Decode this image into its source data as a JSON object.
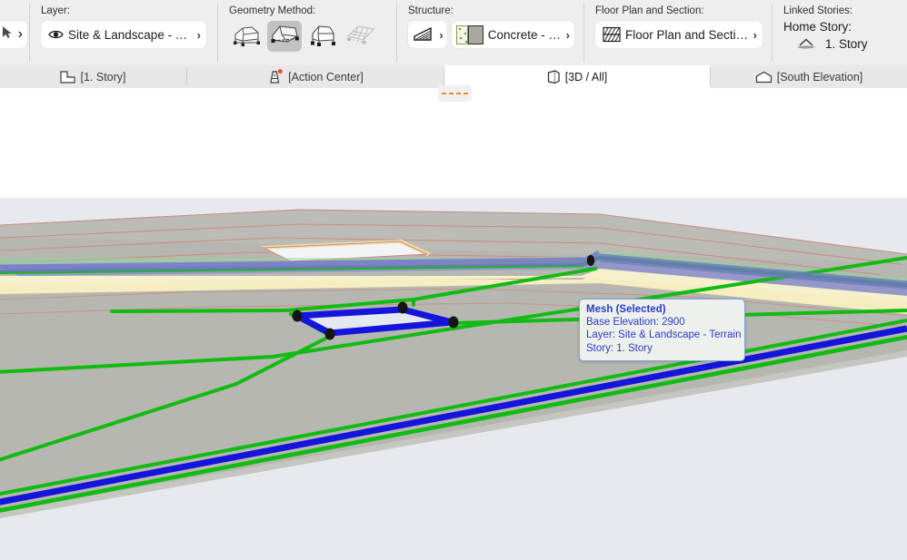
{
  "toolbar": {
    "groups": {
      "tool_edge": {
        "icon": "arrow-tool-icon",
        "chevron": "›"
      },
      "layer": {
        "label": "Layer:",
        "icon": "eye-icon",
        "value": "Site & Landscape - Terrain",
        "chevron": "›"
      },
      "geometry_method": {
        "label": "Geometry Method:",
        "options": [
          {
            "name": "mesh-polygonal-icon",
            "state": "normal"
          },
          {
            "name": "mesh-rectangular-icon",
            "state": "active"
          },
          {
            "name": "mesh-rotated-rectangle-icon",
            "state": "normal"
          },
          {
            "name": "mesh-grid-icon",
            "state": "disabled"
          }
        ]
      },
      "structure": {
        "label": "Structure:",
        "icon": "mesh-structure-icon",
        "icon_chevron": "›",
        "swatch": "concrete-composite-swatch",
        "value": "Concrete - St...",
        "chevron": "›"
      },
      "floor_plan_and_section": {
        "label": "Floor Plan and Section:",
        "icon": "floor-plan-section-icon",
        "value": "Floor Plan and Section...",
        "chevron": "›"
      },
      "linked_stories": {
        "label": "Linked Stories:",
        "home_story_label": "Home Story:",
        "home_story_icon": "home-story-icon",
        "home_story_value": "1. Story"
      }
    }
  },
  "tabs": [
    {
      "label": "[1. Story]",
      "icon": "floor-plan-icon",
      "active": false
    },
    {
      "label": "[Action Center]",
      "icon": "action-center-icon",
      "active": false,
      "badge": true
    },
    {
      "label": "[3D / All]",
      "icon": "cube-3d-icon",
      "active": true
    },
    {
      "label": "[South Elevation]",
      "icon": "elevation-icon",
      "active": false
    }
  ],
  "floating_marker": {
    "name": "dashed-line-marker",
    "color": "#ef8724"
  },
  "tooltip": {
    "title": "Mesh (Selected)",
    "lines": [
      "Base Elevation: 2900",
      "Layer: Site & Landscape - Terrain",
      "Story: 1. Story"
    ],
    "text_color": "#2b3cc8",
    "border_color": "#7ea6d8",
    "background_color": "#eef0ee"
  },
  "viewport": {
    "name": "3d-terrain-view",
    "sky_color": "#e6eaee",
    "terrain_color": "#b7b7b1",
    "terrain_color_light": "#c6c6c0",
    "contour_color": "#c98b87",
    "band_yellow": "#f6eec1",
    "band_blue": "#8d93cc",
    "selection_color": "#1414dc",
    "edge_green": "#12bb12",
    "node_color": "#151515",
    "selected_mesh_fill": "#e4e9ef",
    "selected_mesh": {
      "base_elevation": 2900,
      "vertices": 4
    }
  }
}
